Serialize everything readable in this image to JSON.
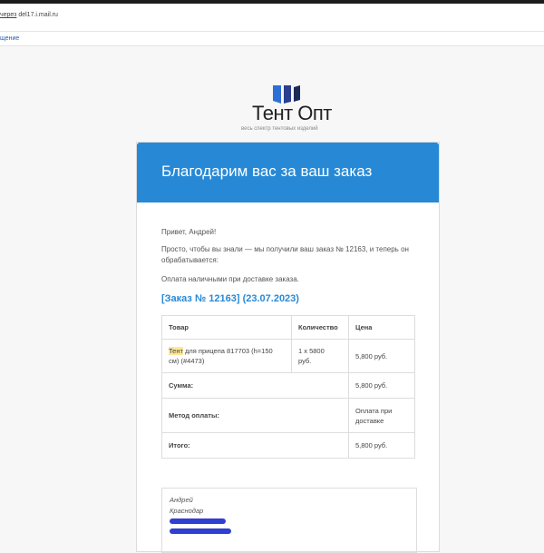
{
  "browser": {
    "via_prefix": "через",
    "via_domain": "del17.i.mail.ru",
    "sub_link": "щение"
  },
  "logo": {
    "brand_name": "Тент Опт",
    "tagline": "весь спектр тентовых изделий",
    "colors": [
      "#2e6fd6",
      "#2a3f8f",
      "#1b2a57"
    ]
  },
  "email": {
    "header_title": "Благодарим вас за ваш заказ",
    "header_color": "#2789d6",
    "greeting": "Привет, Андрей!",
    "intro_line1": "Просто, чтобы вы знали — мы получили ваш заказ № 12163, и теперь он",
    "intro_line2": "обрабатывается:",
    "payment_note": "Оплата наличными при доставке заказа.",
    "order_title": "[Заказ № 12163] (23.07.2023)",
    "table": {
      "headers": [
        "Товар",
        "Количество",
        "Цена"
      ],
      "item": {
        "highlight": "Тент",
        "name_rest_line1": " для прицепа 817703 (h=150",
        "name_line2": "см) (#4473)",
        "qty_line1": "1 x 5800",
        "qty_line2": "руб.",
        "price": "5,800 руб."
      },
      "subtotal_label": "Сумма:",
      "subtotal_value": "5,800 руб.",
      "method_label": "Метод оплаты:",
      "method_value_line1": "Оплата при",
      "method_value_line2": "доставке",
      "total_label": "Итого:",
      "total_value": "5,800 руб."
    },
    "address": {
      "name": "Андрей",
      "city": "Краснодар"
    }
  }
}
